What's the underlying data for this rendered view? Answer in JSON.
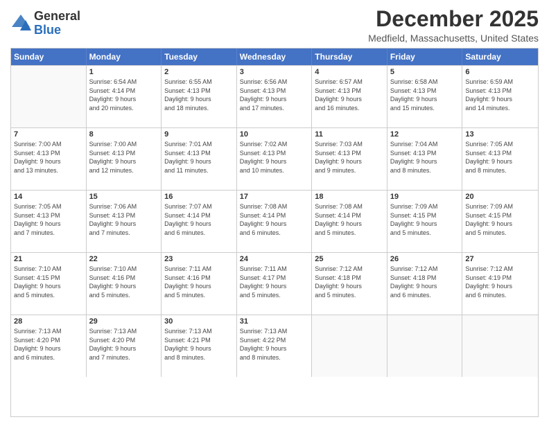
{
  "logo": {
    "line1": "General",
    "line2": "Blue"
  },
  "header": {
    "month": "December 2025",
    "location": "Medfield, Massachusetts, United States"
  },
  "weekdays": [
    "Sunday",
    "Monday",
    "Tuesday",
    "Wednesday",
    "Thursday",
    "Friday",
    "Saturday"
  ],
  "weeks": [
    [
      {
        "day": "",
        "info": ""
      },
      {
        "day": "1",
        "info": "Sunrise: 6:54 AM\nSunset: 4:14 PM\nDaylight: 9 hours\nand 20 minutes."
      },
      {
        "day": "2",
        "info": "Sunrise: 6:55 AM\nSunset: 4:13 PM\nDaylight: 9 hours\nand 18 minutes."
      },
      {
        "day": "3",
        "info": "Sunrise: 6:56 AM\nSunset: 4:13 PM\nDaylight: 9 hours\nand 17 minutes."
      },
      {
        "day": "4",
        "info": "Sunrise: 6:57 AM\nSunset: 4:13 PM\nDaylight: 9 hours\nand 16 minutes."
      },
      {
        "day": "5",
        "info": "Sunrise: 6:58 AM\nSunset: 4:13 PM\nDaylight: 9 hours\nand 15 minutes."
      },
      {
        "day": "6",
        "info": "Sunrise: 6:59 AM\nSunset: 4:13 PM\nDaylight: 9 hours\nand 14 minutes."
      }
    ],
    [
      {
        "day": "7",
        "info": "Sunrise: 7:00 AM\nSunset: 4:13 PM\nDaylight: 9 hours\nand 13 minutes."
      },
      {
        "day": "8",
        "info": "Sunrise: 7:00 AM\nSunset: 4:13 PM\nDaylight: 9 hours\nand 12 minutes."
      },
      {
        "day": "9",
        "info": "Sunrise: 7:01 AM\nSunset: 4:13 PM\nDaylight: 9 hours\nand 11 minutes."
      },
      {
        "day": "10",
        "info": "Sunrise: 7:02 AM\nSunset: 4:13 PM\nDaylight: 9 hours\nand 10 minutes."
      },
      {
        "day": "11",
        "info": "Sunrise: 7:03 AM\nSunset: 4:13 PM\nDaylight: 9 hours\nand 9 minutes."
      },
      {
        "day": "12",
        "info": "Sunrise: 7:04 AM\nSunset: 4:13 PM\nDaylight: 9 hours\nand 8 minutes."
      },
      {
        "day": "13",
        "info": "Sunrise: 7:05 AM\nSunset: 4:13 PM\nDaylight: 9 hours\nand 8 minutes."
      }
    ],
    [
      {
        "day": "14",
        "info": "Sunrise: 7:05 AM\nSunset: 4:13 PM\nDaylight: 9 hours\nand 7 minutes."
      },
      {
        "day": "15",
        "info": "Sunrise: 7:06 AM\nSunset: 4:13 PM\nDaylight: 9 hours\nand 7 minutes."
      },
      {
        "day": "16",
        "info": "Sunrise: 7:07 AM\nSunset: 4:14 PM\nDaylight: 9 hours\nand 6 minutes."
      },
      {
        "day": "17",
        "info": "Sunrise: 7:08 AM\nSunset: 4:14 PM\nDaylight: 9 hours\nand 6 minutes."
      },
      {
        "day": "18",
        "info": "Sunrise: 7:08 AM\nSunset: 4:14 PM\nDaylight: 9 hours\nand 5 minutes."
      },
      {
        "day": "19",
        "info": "Sunrise: 7:09 AM\nSunset: 4:15 PM\nDaylight: 9 hours\nand 5 minutes."
      },
      {
        "day": "20",
        "info": "Sunrise: 7:09 AM\nSunset: 4:15 PM\nDaylight: 9 hours\nand 5 minutes."
      }
    ],
    [
      {
        "day": "21",
        "info": "Sunrise: 7:10 AM\nSunset: 4:15 PM\nDaylight: 9 hours\nand 5 minutes."
      },
      {
        "day": "22",
        "info": "Sunrise: 7:10 AM\nSunset: 4:16 PM\nDaylight: 9 hours\nand 5 minutes."
      },
      {
        "day": "23",
        "info": "Sunrise: 7:11 AM\nSunset: 4:16 PM\nDaylight: 9 hours\nand 5 minutes."
      },
      {
        "day": "24",
        "info": "Sunrise: 7:11 AM\nSunset: 4:17 PM\nDaylight: 9 hours\nand 5 minutes."
      },
      {
        "day": "25",
        "info": "Sunrise: 7:12 AM\nSunset: 4:18 PM\nDaylight: 9 hours\nand 5 minutes."
      },
      {
        "day": "26",
        "info": "Sunrise: 7:12 AM\nSunset: 4:18 PM\nDaylight: 9 hours\nand 6 minutes."
      },
      {
        "day": "27",
        "info": "Sunrise: 7:12 AM\nSunset: 4:19 PM\nDaylight: 9 hours\nand 6 minutes."
      }
    ],
    [
      {
        "day": "28",
        "info": "Sunrise: 7:13 AM\nSunset: 4:20 PM\nDaylight: 9 hours\nand 6 minutes."
      },
      {
        "day": "29",
        "info": "Sunrise: 7:13 AM\nSunset: 4:20 PM\nDaylight: 9 hours\nand 7 minutes."
      },
      {
        "day": "30",
        "info": "Sunrise: 7:13 AM\nSunset: 4:21 PM\nDaylight: 9 hours\nand 8 minutes."
      },
      {
        "day": "31",
        "info": "Sunrise: 7:13 AM\nSunset: 4:22 PM\nDaylight: 9 hours\nand 8 minutes."
      },
      {
        "day": "",
        "info": ""
      },
      {
        "day": "",
        "info": ""
      },
      {
        "day": "",
        "info": ""
      }
    ]
  ]
}
